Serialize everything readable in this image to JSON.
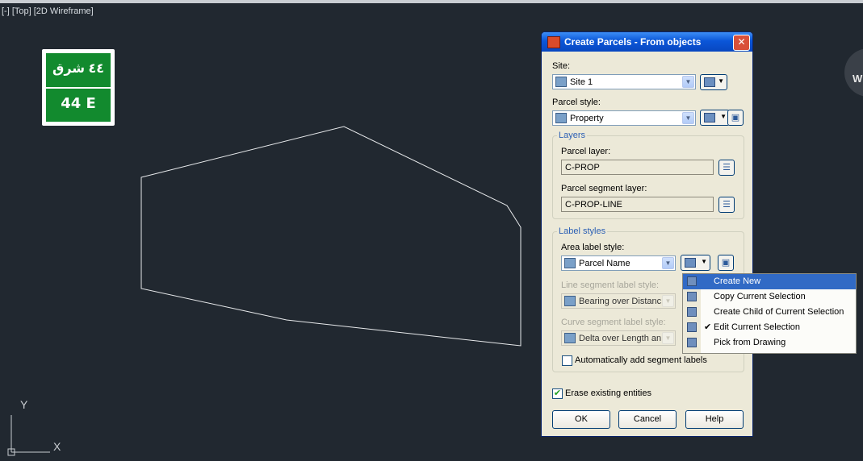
{
  "viewport": {
    "label": "[-] [Top] [2D Wireframe]"
  },
  "sign": {
    "arabic": "٤٤ شرق",
    "english": "44 E"
  },
  "compass": {
    "west": "W"
  },
  "ucs": {
    "y": "Y",
    "x": "X"
  },
  "dialog": {
    "title": "Create Parcels - From objects",
    "close": "✕",
    "site_label": "Site:",
    "site_value": "Site 1",
    "parcel_style_label": "Parcel style:",
    "parcel_style_value": "Property",
    "layers": {
      "title": "Layers",
      "parcel_layer_label": "Parcel layer:",
      "parcel_layer_value": "C-PROP",
      "segment_layer_label": "Parcel segment layer:",
      "segment_layer_value": "C-PROP-LINE"
    },
    "label_styles": {
      "title": "Label styles",
      "area_label": "Area label style:",
      "area_value": "Parcel Name",
      "line_label": "Line segment label style:",
      "line_value": "Bearing over Distanc",
      "curve_label": "Curve segment label style:",
      "curve_value": "Delta over Length an",
      "auto_add_label": "Automatically add segment labels",
      "auto_add_checked": false
    },
    "erase_label": "Erase existing entities",
    "erase_checked": true,
    "ok": "OK",
    "cancel": "Cancel",
    "help": "Help"
  },
  "menu": {
    "items": [
      {
        "label": "Create New",
        "highlighted": true,
        "checked": false
      },
      {
        "label": "Copy Current Selection",
        "highlighted": false,
        "checked": false
      },
      {
        "label": "Create Child of Current Selection",
        "highlighted": false,
        "checked": false
      },
      {
        "label": "Edit Current Selection",
        "highlighted": false,
        "checked": true
      },
      {
        "label": "Pick from Drawing",
        "highlighted": false,
        "checked": false
      }
    ],
    "check_glyph": "✔"
  }
}
